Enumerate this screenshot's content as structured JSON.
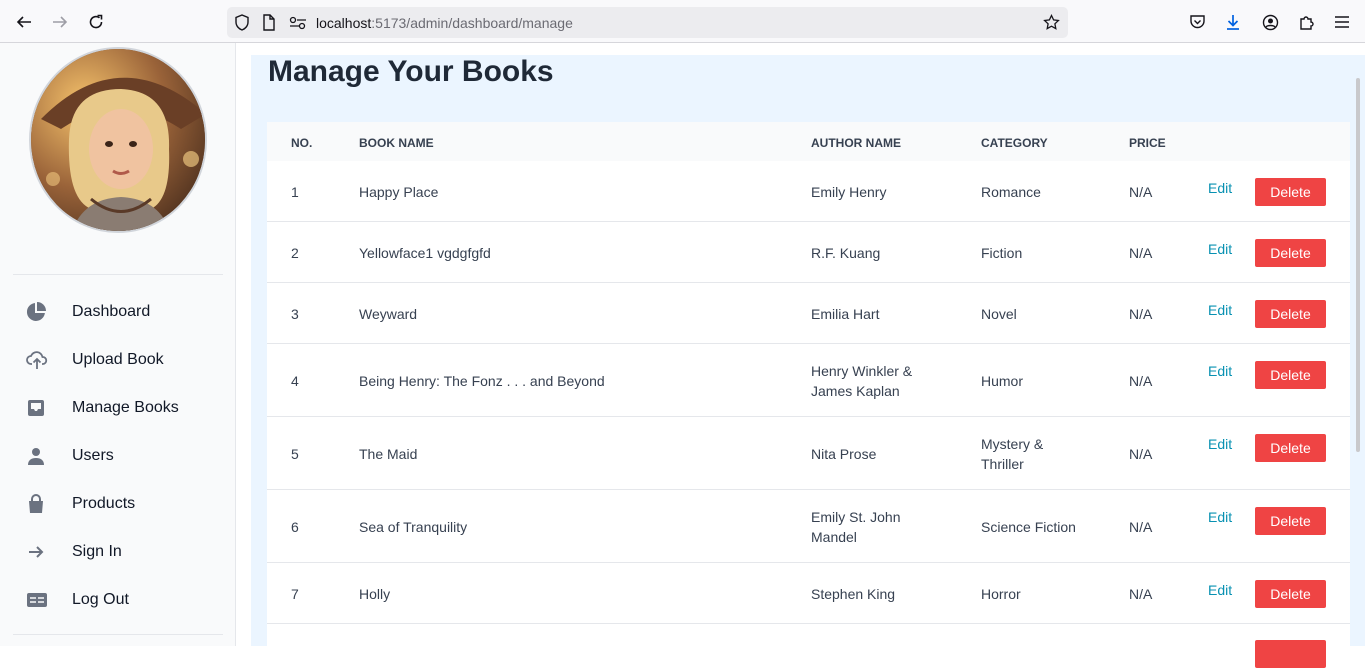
{
  "browser": {
    "url_host": "localhost",
    "url_path": ":5173/admin/dashboard/manage"
  },
  "sidebar": {
    "items": [
      {
        "label": "Dashboard",
        "icon": "chart-pie-icon"
      },
      {
        "label": "Upload Book",
        "icon": "cloud-upload-icon"
      },
      {
        "label": "Manage Books",
        "icon": "inbox-icon"
      },
      {
        "label": "Users",
        "icon": "user-icon"
      },
      {
        "label": "Products",
        "icon": "shopping-bag-icon"
      },
      {
        "label": "Sign In",
        "icon": "arrow-right-icon"
      },
      {
        "label": "Log Out",
        "icon": "table-icon"
      }
    ]
  },
  "main": {
    "title": "Manage Your Books",
    "columns": [
      "NO.",
      "BOOK NAME",
      "AUTHOR NAME",
      "CATEGORY",
      "PRICE"
    ],
    "edit_label": "Edit",
    "delete_label": "Delete",
    "rows": [
      {
        "no": "1",
        "book": "Happy Place",
        "author": "Emily Henry",
        "category": "Romance",
        "price": "N/A"
      },
      {
        "no": "2",
        "book": "Yellowface1 vgdgfgfd",
        "author": "R.F. Kuang",
        "category": "Fiction",
        "price": "N/A"
      },
      {
        "no": "3",
        "book": "Weyward",
        "author": "Emilia Hart",
        "category": "Novel",
        "price": "N/A"
      },
      {
        "no": "4",
        "book": "Being Henry: The Fonz . . . and Beyond",
        "author": "Henry Winkler & James Kaplan",
        "category": "Humor",
        "price": "N/A"
      },
      {
        "no": "5",
        "book": "The Maid",
        "author": "Nita Prose",
        "category": "Mystery & Thriller",
        "price": "N/A"
      },
      {
        "no": "6",
        "book": "Sea of Tranquility",
        "author": "Emily St. John Mandel",
        "category": "Science Fiction",
        "price": "N/A"
      },
      {
        "no": "7",
        "book": "Holly",
        "author": "Stephen King",
        "category": "Horror",
        "price": "N/A"
      }
    ]
  },
  "colors": {
    "accent_delete": "#ef4444",
    "link_edit": "#0891b2",
    "main_bg": "#ebf5ff"
  }
}
